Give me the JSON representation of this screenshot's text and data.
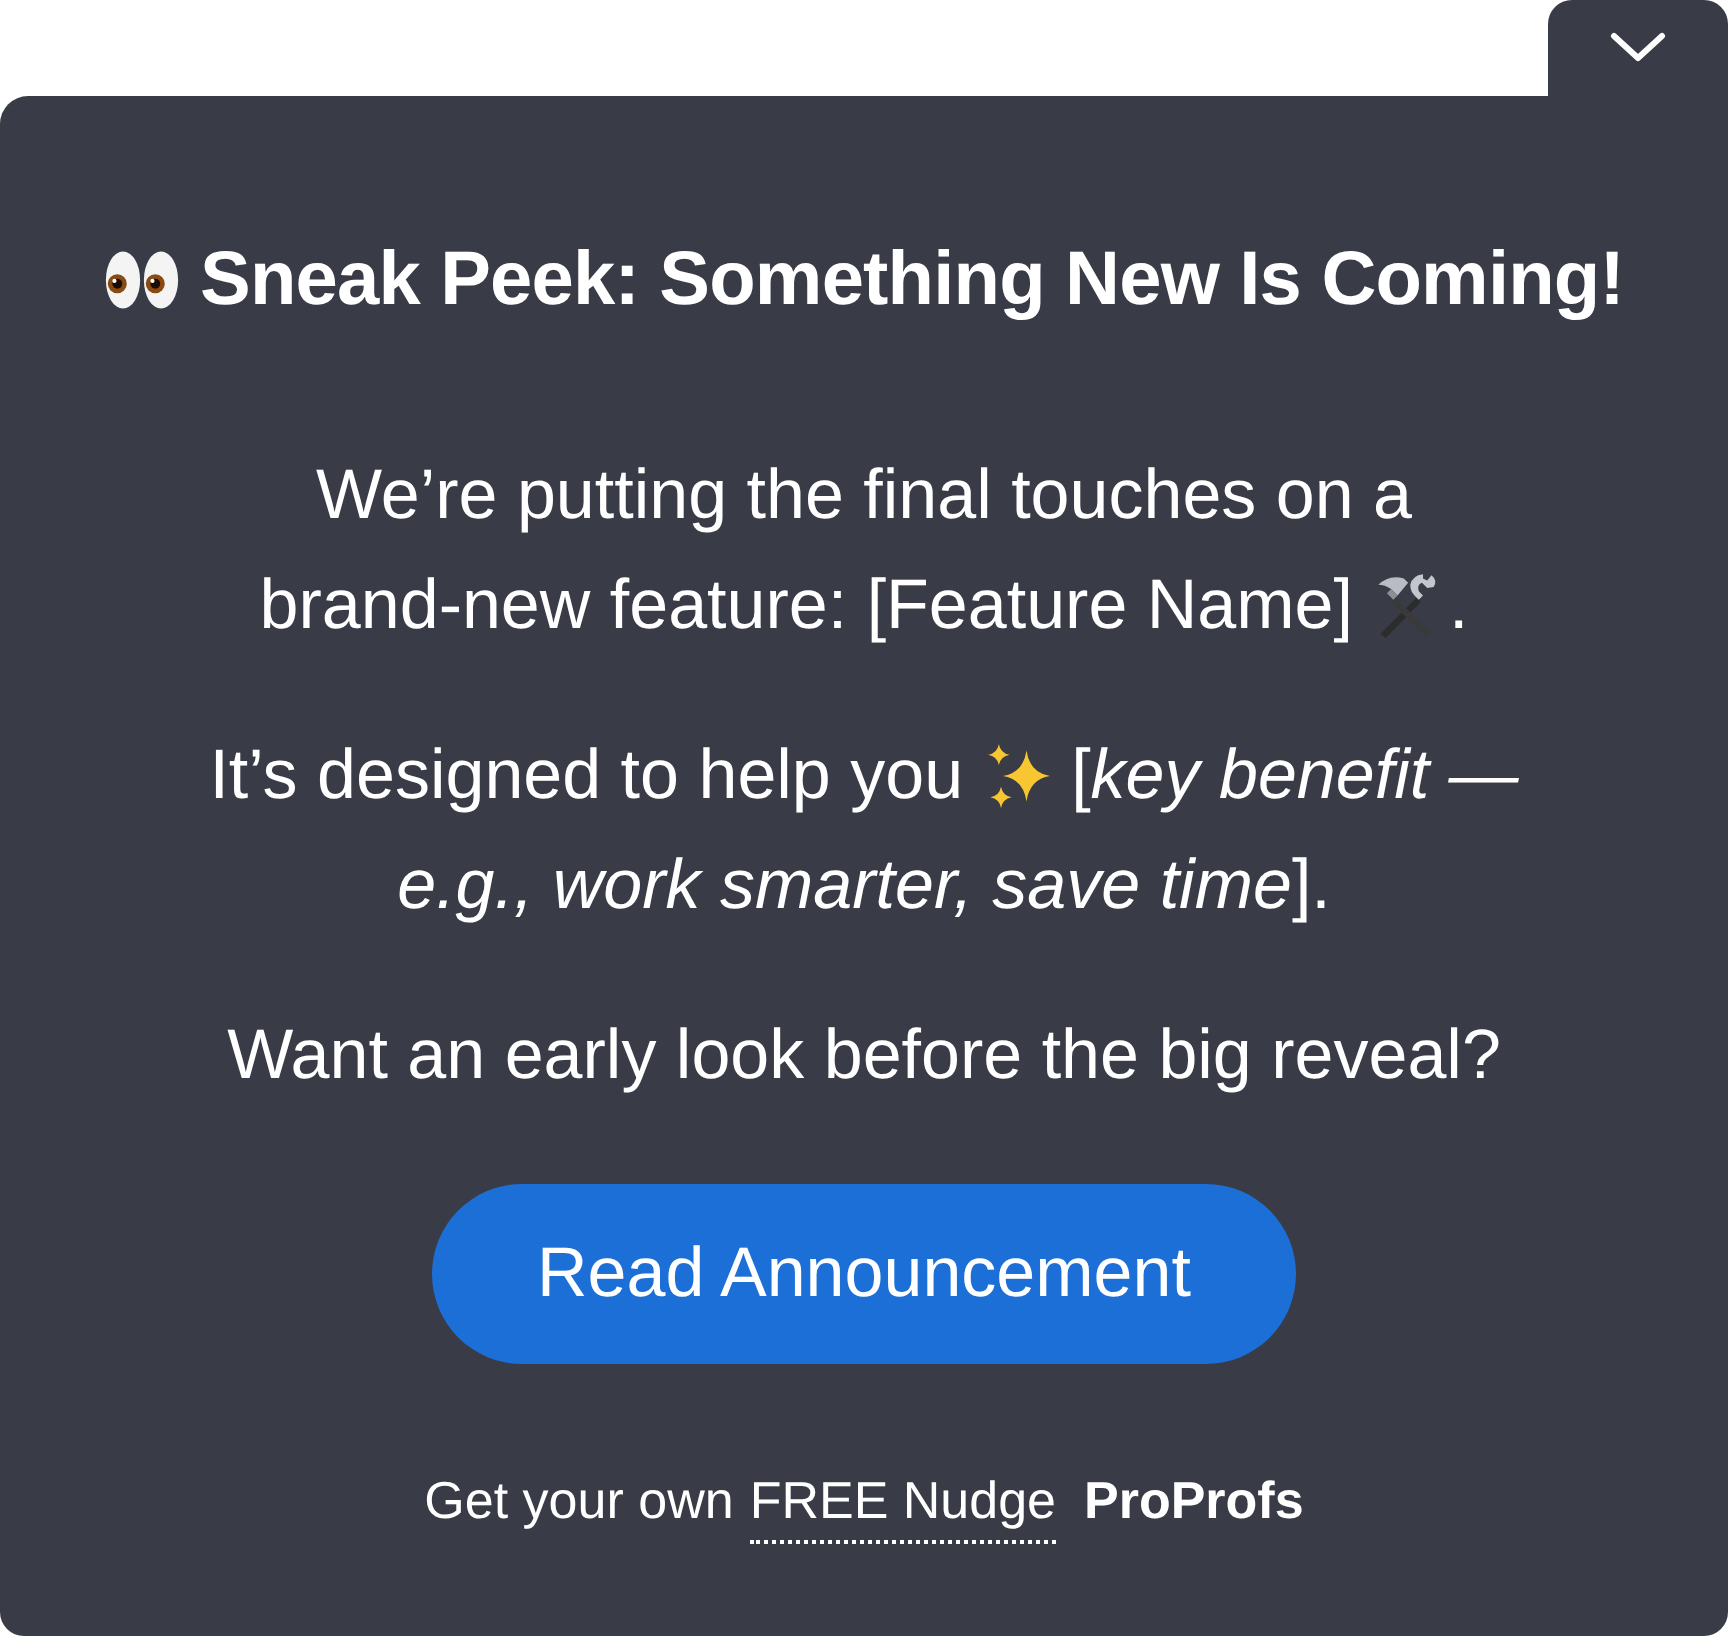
{
  "heading": [
    {
      "kind": "eyes"
    },
    {
      "kind": "text",
      "text": "Sneak Peek: Something New Is Coming!"
    }
  ],
  "paragraphs": [
    {
      "lines": [
        [
          {
            "kind": "text",
            "text": "We’re putting the final touches on a"
          }
        ],
        [
          {
            "kind": "text",
            "text": "brand-new feature: [Feature Name]"
          },
          {
            "kind": "tools"
          },
          {
            "kind": "text",
            "text": "."
          }
        ]
      ]
    },
    {
      "lines": [
        [
          {
            "kind": "text",
            "text": "It’s designed to help you"
          },
          {
            "kind": "sparkles"
          },
          {
            "kind": "text",
            "text": "[*key benefit —*"
          }
        ],
        [
          {
            "kind": "text",
            "text": "*e.g., work smarter, save time*]."
          }
        ]
      ]
    },
    {
      "lines": [
        [
          {
            "kind": "text",
            "text": "Want an early look before the big reveal?"
          }
        ]
      ]
    }
  ],
  "button": {
    "label": "Read Announcement"
  },
  "footer": {
    "text": "Get your own",
    "link": "FREE Nudge",
    "brand": "ProProfs"
  }
}
